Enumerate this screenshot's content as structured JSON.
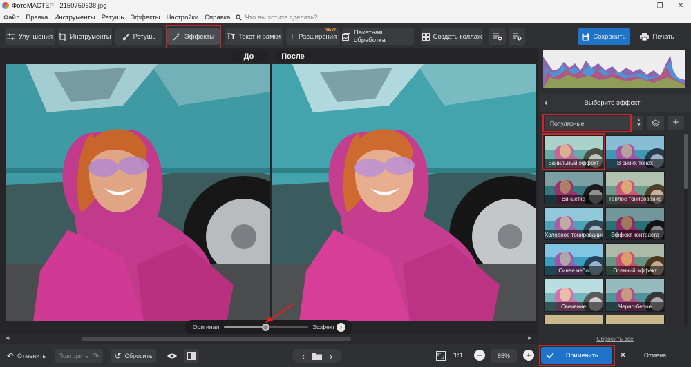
{
  "window": {
    "title": "ФотоМАСТЕР - 2150759638.jpg"
  },
  "menu": {
    "items": [
      "Файл",
      "Правка",
      "Инструменты",
      "Ретушь",
      "Эффекты",
      "Настройки",
      "Справка"
    ],
    "search_placeholder": "Что вы хотите сделать?"
  },
  "toolbar": {
    "improvements": "Улучшения",
    "tools": "Инструменты",
    "retouch": "Ретушь",
    "effects": "Эффекты",
    "text_frames": "Текст и рамки",
    "extensions": "Расширения",
    "extensions_badge": "NEW",
    "batch": "Пакетная обработка",
    "collage": "Создать коллаж",
    "save": "Сохранить",
    "print": "Печать"
  },
  "compare": {
    "before": "До",
    "after": "После"
  },
  "effect_slider": {
    "left_label": "Оригинал",
    "right_label": "Эффект",
    "level": 0.5
  },
  "panel": {
    "title": "Выберите эффект",
    "category": "Популярные",
    "effects": [
      {
        "name": "Ванильный эффект",
        "tint": "#c8d6b0"
      },
      {
        "name": "В синих тонах",
        "tint": "#4a8fd8"
      },
      {
        "name": "Виньетка",
        "tint": "#222222"
      },
      {
        "name": "Теплое тонирование",
        "tint": "#e0a050"
      },
      {
        "name": "Холодное тонирование",
        "tint": "#6fb8e8"
      },
      {
        "name": "Эффект контраста",
        "tint": "#000000"
      },
      {
        "name": "Синее небо",
        "tint": "#3aa6ff"
      },
      {
        "name": "Осенний эффект",
        "tint": "#d08030"
      },
      {
        "name": "Свечение",
        "tint": "#ffffff"
      },
      {
        "name": "Черно-белое",
        "tint": "#808080"
      }
    ],
    "reset_all": "Сбросить все",
    "apply": "Применить",
    "cancel": "Отмена"
  },
  "bottom": {
    "undo": "Отменить",
    "redo": "Повторить",
    "reset": "Сбросить",
    "ratio": "1:1",
    "zoom": "85%"
  }
}
